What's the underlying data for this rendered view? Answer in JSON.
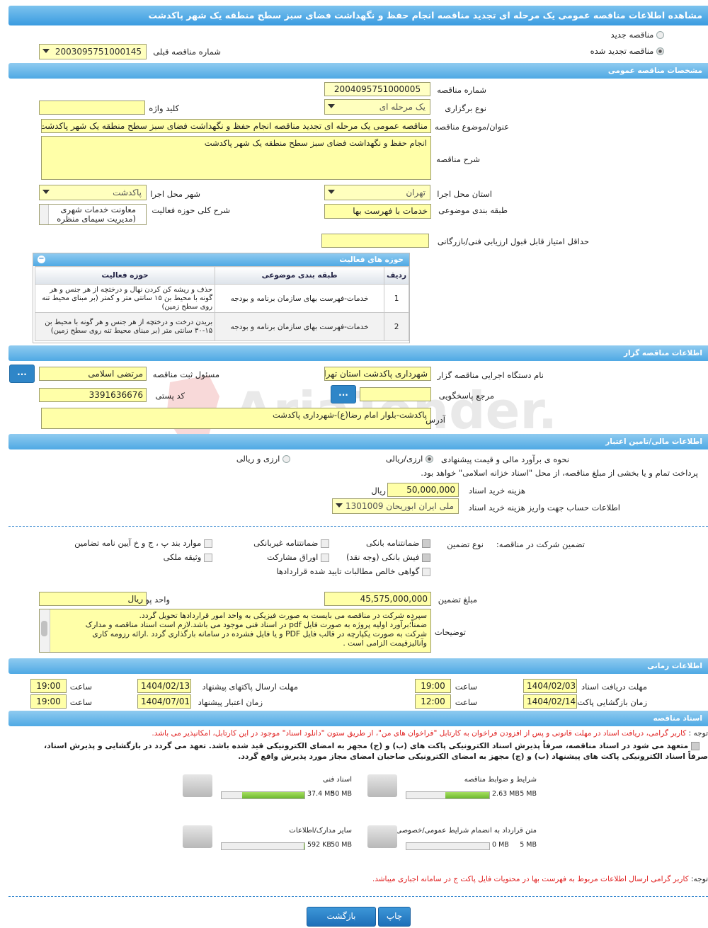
{
  "page_title": "مشاهده اطلاعات مناقصه عمومی یک مرحله ای تجدید مناقصه انجام حفظ و نگهداشت فضای سبز سطح منطقه یک شهر پاکدشت",
  "tender_type": {
    "new_label": "مناقصه جدید",
    "renewed_label": "مناقصه تجدید شده",
    "prev_number_label": "شماره مناقصه قبلی",
    "prev_number_value": "2003095751000145"
  },
  "general": {
    "section_title": "مشخصات مناقصه عمومی",
    "number_label": "شماره مناقصه",
    "number_value": "2004095751000005",
    "holding_type_label": "نوع برگزاری",
    "holding_type_value": "یک مرحله ای",
    "keyword_label": "کلید واژه",
    "keyword_value": "",
    "subject_label": "عنوان/موضوع مناقصه",
    "subject_value": "مناقصه عمومی یک مرحله ای تجدید مناقصه انجام حفظ و نگهداشت فضای سبز سطح منطقه یک شهر پاکدشت",
    "description_label": "شرح مناقصه",
    "description_value": "انجام حفظ و نگهداشت فضای سبز سطح منطقه یک شهر پاکدشت",
    "province_label": "استان محل اجرا",
    "province_value": "تهران",
    "city_label": "شهر محل اجرا",
    "city_value": "پاکدشت",
    "category_label": "طبقه بندی موضوعی",
    "category_value": "خدمات با فهرست بها",
    "activity_desc_label": "شرح کلی حوزه فعالیت",
    "activity_desc_line1": "معاونت خدمات شهری",
    "activity_desc_line2": "(مدیریت سیمای منظره",
    "min_score_label": "حداقل امتیاز قابل قبول ارزیابی فنی/بازرگانی",
    "min_score_value": ""
  },
  "activities": {
    "title": "حوزه های فعالیت",
    "headers": [
      "ردیف",
      "طبقه بندی موضوعی",
      "حوزه فعالیت"
    ],
    "rows": [
      {
        "row": "1",
        "category": "خدمات-فهرست بهای سازمان برنامه و بودجه",
        "field": "حذف و ریشه کن کردن نهال و درختچه از هر جنس و هر گونه با محیط بن ۱۵ سانتی متر و کمتر (بر مبنای محیط تنه روی سطح زمین)"
      },
      {
        "row": "2",
        "category": "خدمات-فهرست بهای سازمان برنامه و بودجه",
        "field": "بریدن درخت و درختچه از هر جنس و هر گونه با محیط بن ۱۵-۳۰ سانتی متر (بر مبنای محیط تنه روی سطح زمین)"
      }
    ]
  },
  "organizer": {
    "section_title": "اطلاعات مناقصه گزار",
    "org_name_label": "نام دستگاه اجرایی مناقصه گزار",
    "org_name_value": "شهرداری پاکدشت استان تهران",
    "registrar_label": "مسئول ثبت مناقصه",
    "registrar_value": "مرتضی اسلامی",
    "response_ref_label": "مرجع پاسخگویی",
    "response_ref_value": "",
    "postal_label": "کد پستی",
    "postal_value": "3391636676",
    "address_label": "آدرس",
    "address_value": "پاکدشت-بلوار امام رضا(ع)-شهرداری پاکدشت",
    "dots": "..."
  },
  "financial": {
    "section_title": "اطلاعات مالی/تامین اعتبار",
    "estimate_label": "نحوه ی برآورد مالی و قیمت پیشنهادی",
    "estimate_opt1": "ارزی/ریالی",
    "estimate_opt2": "ارزی و ریالی",
    "treasury_text": "پرداخت تمام و یا بخشی از مبلغ مناقصه، از محل \"اسناد خزانه اسلامی\" خواهد بود.",
    "doc_fee_label": "هزینه خرید اسناد",
    "doc_fee_value": "50,000,000",
    "doc_fee_unit": "ریال",
    "account_label": "اطلاعات حساب جهت واریز هزینه خرید اسناد",
    "account_value": "ملی ایران ابوریحان 1301009"
  },
  "guarantee": {
    "participation_label": "تضمین شرکت در مناقصه:",
    "type_label": "نوع تضمین",
    "options": {
      "bank_guarantee": "ضمانتنامه بانکی",
      "non_bank_guarantee": "ضمانتنامه غیربانکی",
      "clauses": "موارد بند پ ، ج و خ آیین نامه تضامین",
      "cash_receipt": "فیش بانکی (وجه نقد)",
      "bonds": "اوراق مشارکت",
      "property": "وثیقه ملکی",
      "receivables": "گواهی خالص مطالبات تایید شده قراردادها"
    },
    "amount_label": "مبلغ تضمین",
    "amount_value": "45,575,000,000",
    "currency_label": "واحد پول",
    "currency_value": "ریال",
    "notes_label": "توضیحات",
    "notes_lines": [
      "سپرده شرکت در مناقصه می بایست به صورت فیزیکی به واحد امور قراردادها تحویل گردد.",
      "ضمناً؛برآورد اولیه پروژه به صورت فایل pdf در اسناد فنی موجود می باشد.لازم است اسناد مناقصه و مدارک",
      "شرکت به صورت یکپارچه در قالب فایل PDF و یا فایل فشرده در سامانه بارگذاری گردد .ارائه رزومه کاری",
      "وآنالیزقیمت الزامی است ."
    ]
  },
  "timing": {
    "section_title": "اطلاعات زمانی",
    "receive_deadline_label": "مهلت دریافت اسناد",
    "receive_deadline_date": "1404/02/03",
    "receive_deadline_time": "19:00",
    "submit_deadline_label": "مهلت ارسال پاکتهای پیشنهاد",
    "submit_deadline_date": "1404/02/13",
    "submit_deadline_time": "19:00",
    "opening_label": "زمان بازگشایی پاکت ها",
    "opening_date": "1404/02/14",
    "opening_time": "12:00",
    "validity_label": "زمان اعتبار پیشنهاد",
    "validity_date": "1404/07/01",
    "validity_time": "19:00",
    "time_label": "ساعت"
  },
  "documents": {
    "section_title": "اسناد مناقصه",
    "notice_prefix": "توجه :",
    "notice_text": "کاربر گرامی، دریافت اسناد در مهلت قانونی و پس از افزودن فراخوان به کارتابل \"فراخوان های من\"، از طریق ستون \"دانلود اسناد\" موجود در این کارتابل، امکانپذیر می باشد.",
    "commit_line1": "متعهد می شود در اسناد مناقصه، صرفاً پذیرش اسناد الکترونیکی پاکت های (ب) و (ج) مجهز به امضای الکترونیکی قید شده باشد. تعهد می گردد در بازگشایی و پذیرش اسناد،",
    "commit_line2": "صرفاً اسناد الکترونیکی پاکت های پیشنهاد (ب) و (ج) مجهز به امضای الکترونیکی صاحبان امضای مجاز مورد پذیرش واقع گردد.",
    "files": [
      {
        "name": "شرایط و ضوابط مناقصه",
        "size": "2.63 MB",
        "max": "5 MB",
        "fill": 0.53
      },
      {
        "name": "اسناد فنی",
        "size": "37.4 MB",
        "max": "50 MB",
        "fill": 0.75
      },
      {
        "name": "متن قرارداد به انضمام شرایط عمومی/خصوصی",
        "size": "0 MB",
        "max": "5 MB",
        "fill": 0
      },
      {
        "name": "سایر مدارک/اطلاعات",
        "size": "592 KB",
        "max": "50 MB",
        "fill": 0.01
      }
    ],
    "price_list_notice_prefix": "توجه:",
    "price_list_notice": "کاربر گرامی ارسال اطلاعات مربوط به فهرست بها در محتویات فایل پاکت ج در سامانه اجباری میباشد."
  },
  "buttons": {
    "print": "چاپ",
    "back": "بازگشت"
  },
  "watermark": "AriaTender.neT",
  "colors": {
    "header_blue": "#3a9be0",
    "field_yellow": "#ffffa8",
    "notice_red": "#e02020",
    "progress_green": "#6cb830"
  }
}
